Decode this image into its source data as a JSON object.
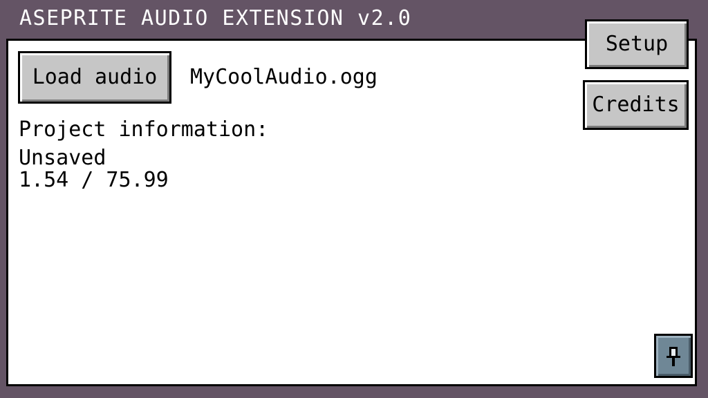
{
  "window": {
    "title": "ASEPRITE AUDIO EXTENSION v2.0"
  },
  "toolbar": {
    "load_audio_label": "Load audio",
    "setup_label": "Setup",
    "credits_label": "Credits"
  },
  "audio": {
    "filename": "MyCoolAudio.ogg"
  },
  "project": {
    "heading": "Project information:",
    "status": "Unsaved",
    "time": "1.54 / 75.99"
  },
  "icons": {
    "pin": "pin-icon"
  },
  "colors": {
    "frame": "#645465",
    "button_face": "#c6c6c6",
    "pin_button": "#6f8796",
    "panel": "#ffffff"
  }
}
